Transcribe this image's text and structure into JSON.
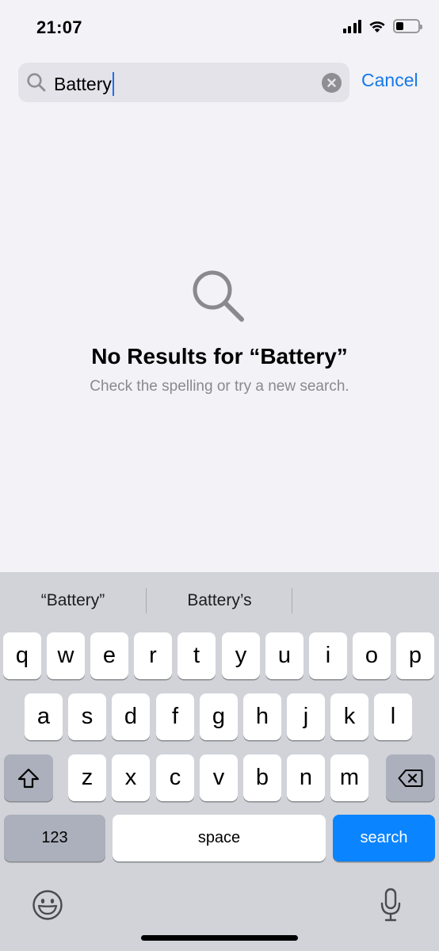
{
  "status_bar": {
    "time": "21:07",
    "icons": [
      "cellular-signal-icon",
      "wifi-icon",
      "battery-icon"
    ],
    "battery_level": 0.35
  },
  "search": {
    "query": "Battery",
    "cancel_label": "Cancel",
    "icon": "search-icon",
    "clear_icon": "clear-icon"
  },
  "empty_state": {
    "icon": "magnifying-glass-icon",
    "title": "No Results for “Battery”",
    "subtitle": "Check the spelling or try a new search."
  },
  "keyboard": {
    "suggestions": [
      "“Battery”",
      "Battery’s",
      ""
    ],
    "row1": [
      "q",
      "w",
      "e",
      "r",
      "t",
      "y",
      "u",
      "i",
      "o",
      "p"
    ],
    "row2": [
      "a",
      "s",
      "d",
      "f",
      "g",
      "h",
      "j",
      "k",
      "l"
    ],
    "row3": [
      "z",
      "x",
      "c",
      "v",
      "b",
      "n",
      "m"
    ],
    "numbers_label": "123",
    "space_label": "space",
    "return_label": "search",
    "shift_icon": "shift-icon",
    "delete_icon": "delete-icon",
    "emoji_icon": "emoji-icon",
    "mic_icon": "microphone-icon"
  },
  "colors": {
    "accent": "#1679e8",
    "search_key": "#0a84ff",
    "background": "#f2f2f7",
    "keyboard_bg": "#d1d3d9"
  }
}
